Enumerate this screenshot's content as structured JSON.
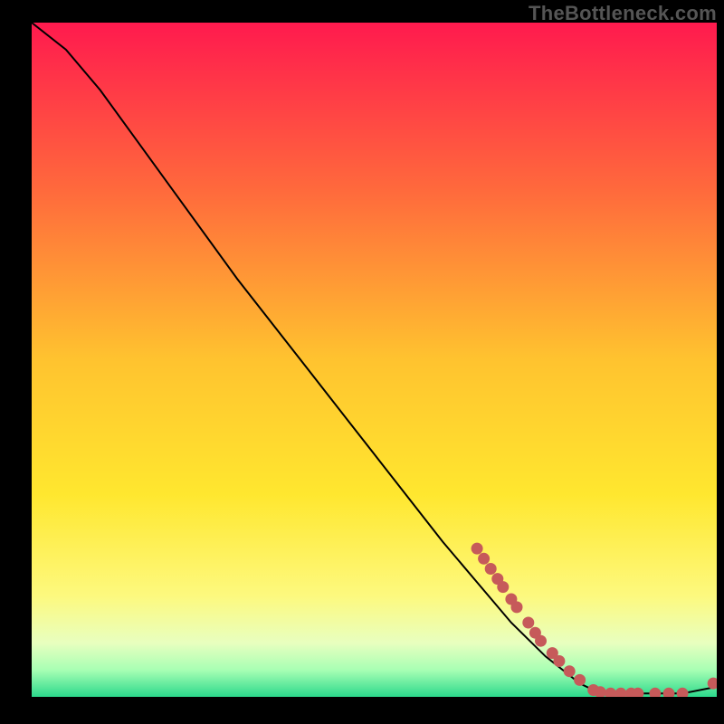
{
  "watermark": "TheBottleneck.com",
  "chart_data": {
    "type": "line",
    "title": "",
    "xlabel": "",
    "ylabel": "",
    "xlim": [
      0,
      100
    ],
    "ylim": [
      0,
      100
    ],
    "background_gradient": {
      "stops": [
        {
          "offset": 0,
          "color": "#ff1a4e"
        },
        {
          "offset": 25,
          "color": "#ff6a3c"
        },
        {
          "offset": 50,
          "color": "#ffc32f"
        },
        {
          "offset": 70,
          "color": "#ffe72f"
        },
        {
          "offset": 85,
          "color": "#fdf97e"
        },
        {
          "offset": 92,
          "color": "#e8ffbf"
        },
        {
          "offset": 96,
          "color": "#a8ffb4"
        },
        {
          "offset": 100,
          "color": "#2cd98c"
        }
      ]
    },
    "series": [
      {
        "name": "curve",
        "type": "line",
        "color": "#000000",
        "points": [
          {
            "x": 0,
            "y": 100
          },
          {
            "x": 5,
            "y": 96
          },
          {
            "x": 10,
            "y": 90
          },
          {
            "x": 15,
            "y": 83
          },
          {
            "x": 20,
            "y": 76
          },
          {
            "x": 30,
            "y": 62
          },
          {
            "x": 40,
            "y": 49
          },
          {
            "x": 50,
            "y": 36
          },
          {
            "x": 60,
            "y": 23
          },
          {
            "x": 65,
            "y": 17
          },
          {
            "x": 70,
            "y": 11
          },
          {
            "x": 75,
            "y": 6
          },
          {
            "x": 80,
            "y": 2
          },
          {
            "x": 82,
            "y": 1
          },
          {
            "x": 85,
            "y": 0.5
          },
          {
            "x": 90,
            "y": 0.5
          },
          {
            "x": 95,
            "y": 0.5
          },
          {
            "x": 100,
            "y": 1.5
          }
        ]
      },
      {
        "name": "dots",
        "type": "scatter",
        "color": "#c65a5a",
        "points": [
          {
            "x": 65,
            "y": 22
          },
          {
            "x": 66,
            "y": 20.5
          },
          {
            "x": 67,
            "y": 19
          },
          {
            "x": 68,
            "y": 17.5
          },
          {
            "x": 68.8,
            "y": 16.3
          },
          {
            "x": 70,
            "y": 14.5
          },
          {
            "x": 70.8,
            "y": 13.3
          },
          {
            "x": 72.5,
            "y": 11
          },
          {
            "x": 73.5,
            "y": 9.5
          },
          {
            "x": 74.3,
            "y": 8.3
          },
          {
            "x": 76,
            "y": 6.5
          },
          {
            "x": 77,
            "y": 5.3
          },
          {
            "x": 78.5,
            "y": 3.8
          },
          {
            "x": 80,
            "y": 2.5
          },
          {
            "x": 82,
            "y": 1
          },
          {
            "x": 83,
            "y": 0.7
          },
          {
            "x": 84.5,
            "y": 0.5
          },
          {
            "x": 86,
            "y": 0.5
          },
          {
            "x": 87.5,
            "y": 0.5
          },
          {
            "x": 88.5,
            "y": 0.5
          },
          {
            "x": 91,
            "y": 0.5
          },
          {
            "x": 93,
            "y": 0.5
          },
          {
            "x": 95,
            "y": 0.5
          },
          {
            "x": 99.5,
            "y": 2
          }
        ]
      }
    ]
  }
}
